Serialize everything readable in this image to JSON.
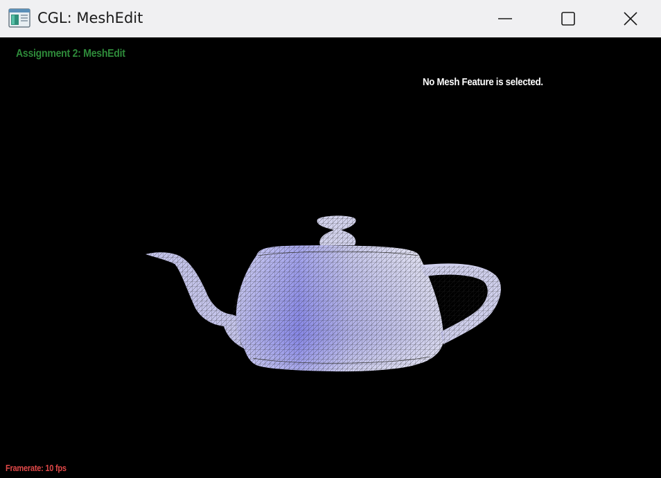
{
  "window": {
    "title": "CGL: MeshEdit",
    "app_icon": "app-window-icon",
    "controls": [
      "minimize-icon",
      "maximize-icon",
      "close-icon"
    ]
  },
  "viewport": {
    "assignment_title": "Assignment 2: MeshEdit",
    "selection_status": "No Mesh Feature is selected.",
    "framerate": "Framerate: 10 fps",
    "model": "teapot-mesh",
    "colors": {
      "background": "#000000",
      "assignment_title": "#2e8b3a",
      "selection_status": "#ffffff",
      "framerate": "#e04848",
      "mesh_fill": "#a9a9e8",
      "mesh_wire": "#2a2a2a"
    }
  }
}
